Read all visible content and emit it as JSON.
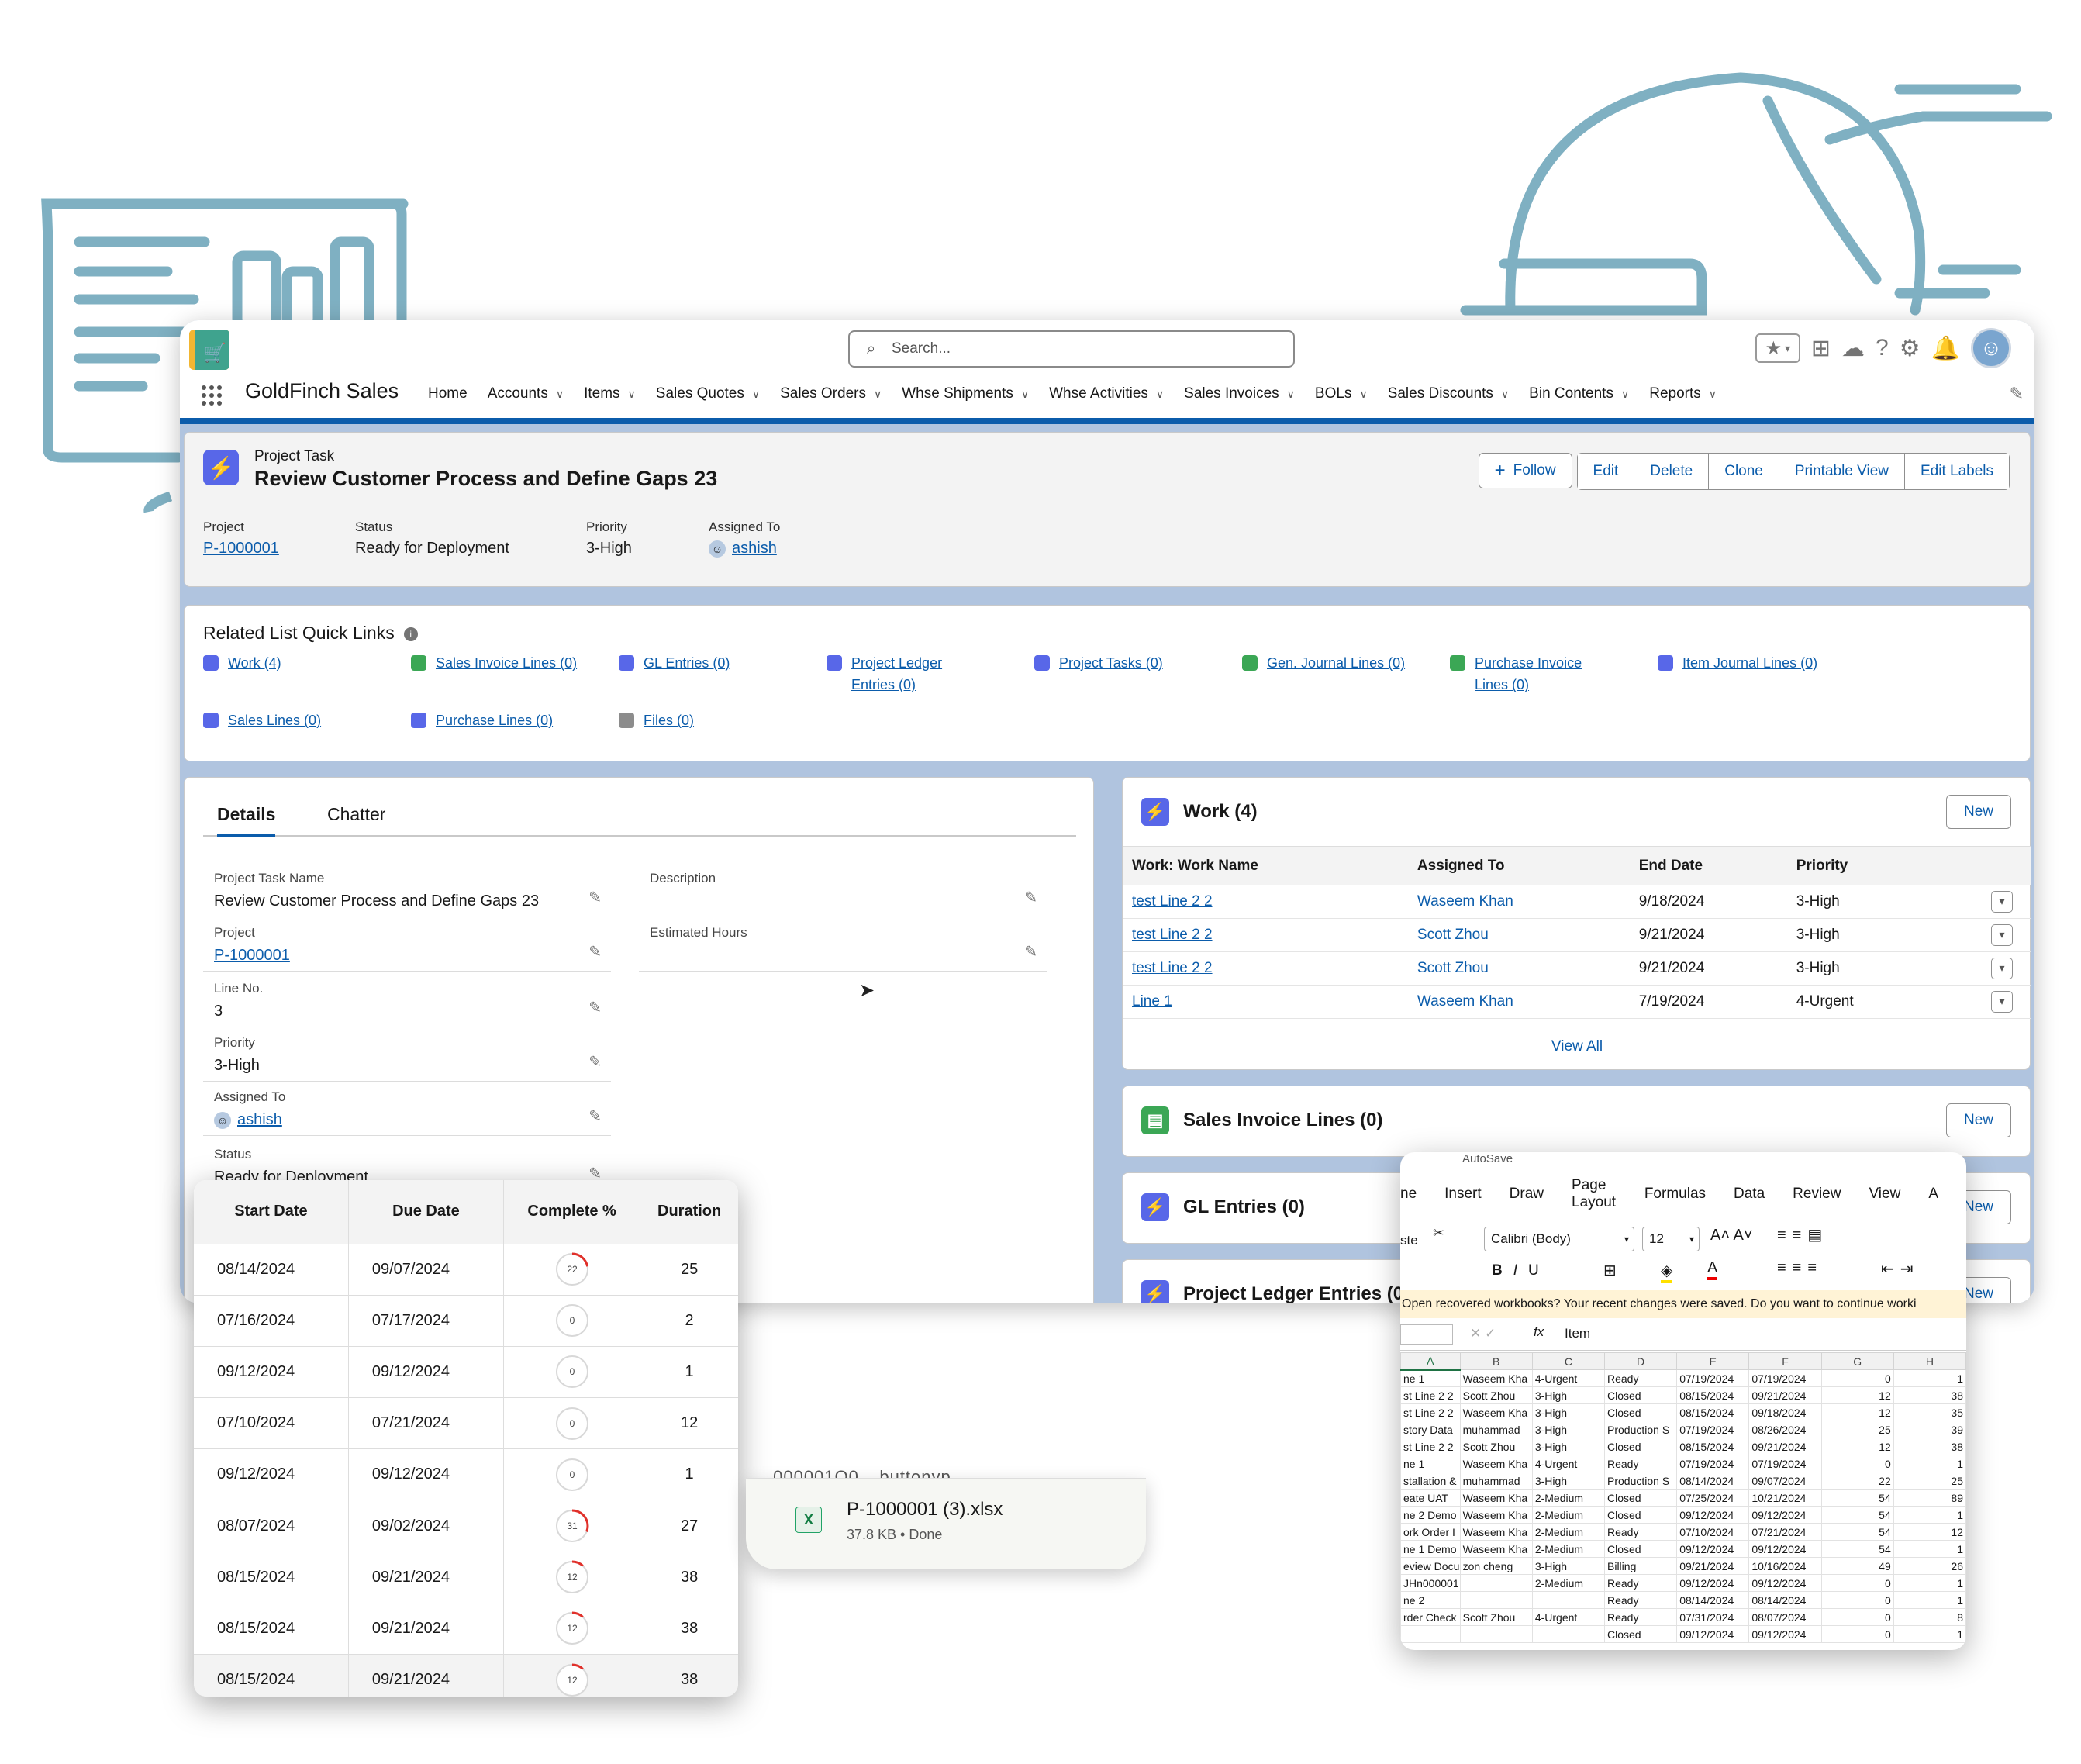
{
  "app": {
    "name": "GoldFinch Sales",
    "search_placeholder": "Search..."
  },
  "nav": {
    "items": [
      {
        "label": "Home",
        "menu": false
      },
      {
        "label": "Accounts",
        "menu": true
      },
      {
        "label": "Items",
        "menu": true
      },
      {
        "label": "Sales Quotes",
        "menu": true
      },
      {
        "label": "Sales Orders",
        "menu": true
      },
      {
        "label": "Whse Shipments",
        "menu": true
      },
      {
        "label": "Whse Activities",
        "menu": true
      },
      {
        "label": "Sales Invoices",
        "menu": true
      },
      {
        "label": "BOLs",
        "menu": true
      },
      {
        "label": "Sales Discounts",
        "menu": true
      },
      {
        "label": "Bin Contents",
        "menu": true
      },
      {
        "label": "Reports",
        "menu": true
      }
    ]
  },
  "record": {
    "object": "Project Task",
    "title": "Review Customer Process and Define Gaps 23",
    "buttons": {
      "follow": "Follow",
      "edit": "Edit",
      "delete": "Delete",
      "clone": "Clone",
      "printable": "Printable View",
      "edit_labels": "Edit Labels"
    },
    "highlights": [
      {
        "label": "Project",
        "value": "P-1000001"
      },
      {
        "label": "Status",
        "value": "Ready for Deployment"
      },
      {
        "label": "Priority",
        "value": "3-High"
      },
      {
        "label": "Assigned To",
        "value": "ashish"
      }
    ]
  },
  "quick_links": {
    "title": "Related List Quick Links",
    "items": [
      "Work (4)",
      "Sales Invoice Lines (0)",
      "GL Entries (0)",
      "Project Ledger Entries (0)",
      "Project Tasks (0)",
      "Gen. Journal Lines (0)",
      "Purchase Invoice Lines (0)",
      "Item Journal Lines (0)",
      "Sales Lines (0)",
      "Purchase Lines (0)",
      "Files (0)"
    ]
  },
  "details": {
    "tabs": [
      "Details",
      "Chatter"
    ],
    "left_fields": [
      {
        "label": "Project Task Name",
        "value": "Review Customer Process and Define Gaps 23"
      },
      {
        "label": "Project",
        "value": "P-1000001"
      },
      {
        "label": "Line No.",
        "value": "3"
      },
      {
        "label": "Priority",
        "value": "3-High"
      },
      {
        "label": "Assigned To",
        "value": "ashish"
      },
      {
        "label": "Status",
        "value": "Ready for Deployment"
      }
    ],
    "right_fields": [
      {
        "label": "Description",
        "value": ""
      },
      {
        "label": "Estimated Hours",
        "value": ""
      }
    ]
  },
  "work": {
    "title": "Work (4)",
    "new": "New",
    "columns": [
      "Work: Work Name",
      "Assigned To",
      "End Date",
      "Priority"
    ],
    "rows": [
      [
        "test Line 2 2",
        "Waseem Khan",
        "9/18/2024",
        "3-High"
      ],
      [
        "test Line 2 2",
        "Scott Zhou",
        "9/21/2024",
        "3-High"
      ],
      [
        "test Line 2 2",
        "Scott Zhou",
        "9/21/2024",
        "3-High"
      ],
      [
        "Line 1",
        "Waseem Khan",
        "7/19/2024",
        "4-Urgent"
      ]
    ],
    "view_all": "View All"
  },
  "sales_invoice_lines": {
    "title": "Sales Invoice Lines (0)",
    "new": "New"
  },
  "gl_entries": {
    "title": "GL Entries (0)",
    "new": "New"
  },
  "project_ledger": {
    "title": "Project Ledger Entries (0)",
    "new": "New"
  },
  "schedule": {
    "columns": [
      "Start Date",
      "Due Date",
      "Complete %",
      "Duration"
    ],
    "rows": [
      [
        "08/14/2024",
        "09/07/2024",
        22,
        "25"
      ],
      [
        "07/16/2024",
        "07/17/2024",
        0,
        "2"
      ],
      [
        "09/12/2024",
        "09/12/2024",
        0,
        "1"
      ],
      [
        "07/10/2024",
        "07/21/2024",
        0,
        "12"
      ],
      [
        "09/12/2024",
        "09/12/2024",
        0,
        "1"
      ],
      [
        "08/07/2024",
        "09/02/2024",
        31,
        "27"
      ],
      [
        "08/15/2024",
        "09/21/2024",
        12,
        "38"
      ],
      [
        "08/15/2024",
        "09/21/2024",
        12,
        "38"
      ],
      [
        "08/15/2024",
        "09/21/2024",
        12,
        "38"
      ]
    ]
  },
  "download": {
    "partial": ".000001Q0__buttonyp...",
    "file": "P-1000001 (3).xlsx",
    "info": "37.8 KB • Done"
  },
  "excel": {
    "autosave": "AutoSave",
    "menu": [
      "ne",
      "Insert",
      "Draw",
      "Page Layout",
      "Formulas",
      "Data",
      "Review",
      "View",
      "A"
    ],
    "font": "Calibri (Body)",
    "size": "12",
    "paste": "ste",
    "message": "Open recovered workbooks?  Your recent changes were saved. Do you want to continue worki",
    "formula": "Item",
    "fx": "fx",
    "cols": [
      "A",
      "B",
      "C",
      "D",
      "E",
      "F",
      "G",
      "H"
    ],
    "rows": [
      [
        "ne 1",
        "Waseem Kha",
        "4-Urgent",
        "Ready",
        "07/19/2024",
        "07/19/2024",
        "0",
        "1"
      ],
      [
        "st Line 2 2",
        "Scott Zhou",
        "3-High",
        "Closed",
        "08/15/2024",
        "09/21/2024",
        "12",
        "38"
      ],
      [
        "st Line 2 2",
        "Waseem Kha",
        "3-High",
        "Closed",
        "08/15/2024",
        "09/18/2024",
        "12",
        "35"
      ],
      [
        "story Data",
        "muhammad",
        "3-High",
        "Production S",
        "07/19/2024",
        "08/26/2024",
        "25",
        "39"
      ],
      [
        "st Line 2 2",
        "Scott Zhou",
        "3-High",
        "Closed",
        "08/15/2024",
        "09/21/2024",
        "12",
        "38"
      ],
      [
        "ne 1",
        "Waseem Kha",
        "4-Urgent",
        "Ready",
        "07/19/2024",
        "07/19/2024",
        "0",
        "1"
      ],
      [
        "stallation &",
        "muhammad",
        "3-High",
        "Production S",
        "08/14/2024",
        "09/07/2024",
        "22",
        "25"
      ],
      [
        "eate UAT",
        "Waseem Kha",
        "2-Medium",
        "Closed",
        "07/25/2024",
        "10/21/2024",
        "54",
        "89"
      ],
      [
        "ne 2 Demo",
        "Waseem Kha",
        "2-Medium",
        "Closed",
        "09/12/2024",
        "09/12/2024",
        "54",
        "1"
      ],
      [
        "ork Order I",
        "Waseem Kha",
        "2-Medium",
        "Ready",
        "07/10/2024",
        "07/21/2024",
        "54",
        "12"
      ],
      [
        "ne 1 Demo",
        "Waseem Kha",
        "2-Medium",
        "Closed",
        "09/12/2024",
        "09/12/2024",
        "54",
        "1"
      ],
      [
        "eview Docu",
        "zon cheng",
        "3-High",
        "Billing",
        "09/21/2024",
        "10/16/2024",
        "49",
        "26"
      ],
      [
        "JHn000001",
        "",
        "2-Medium",
        "Ready",
        "09/12/2024",
        "09/12/2024",
        "0",
        "1"
      ],
      [
        "ne 2",
        "",
        "",
        "Ready",
        "08/14/2024",
        "08/14/2024",
        "0",
        "1"
      ],
      [
        "rder Check",
        "Scott Zhou",
        "4-Urgent",
        "Ready",
        "07/31/2024",
        "08/07/2024",
        "0",
        "8"
      ],
      [
        "",
        "",
        "",
        "Closed",
        "09/12/2024",
        "09/12/2024",
        "0",
        "1"
      ]
    ]
  }
}
